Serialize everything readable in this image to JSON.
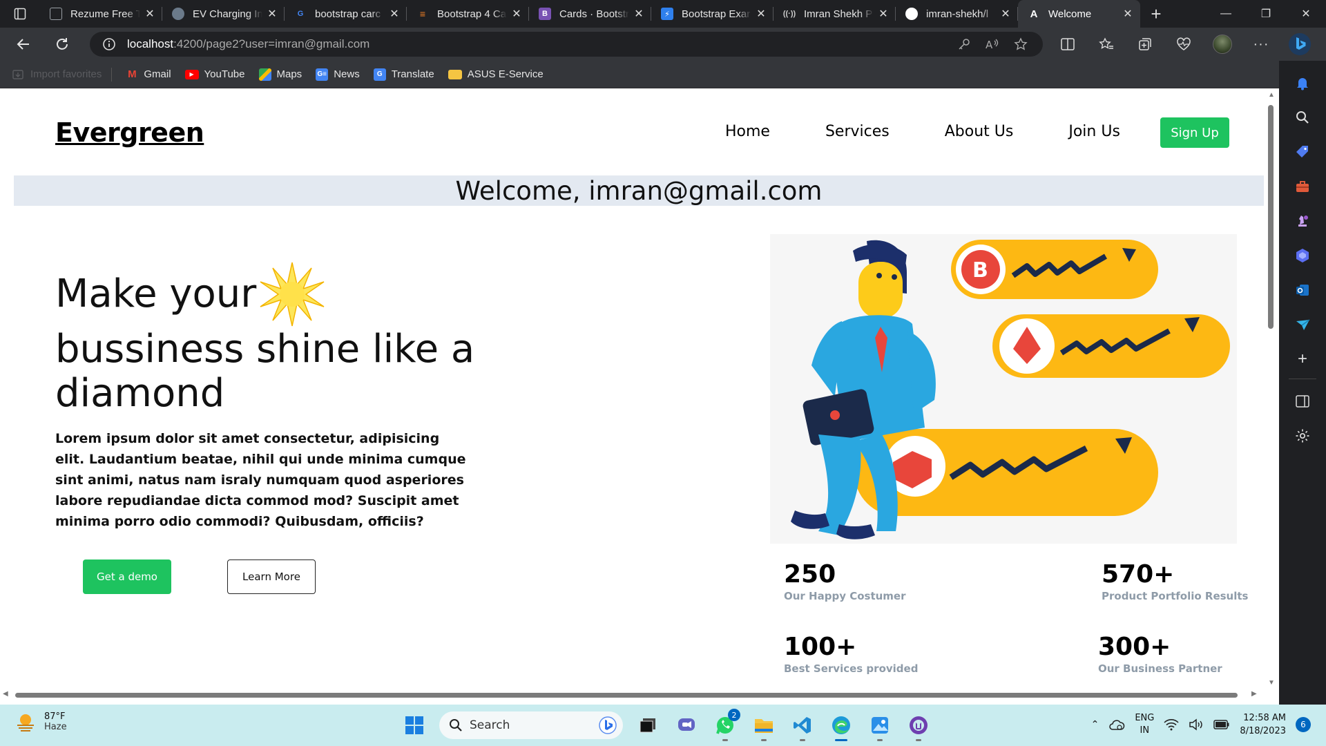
{
  "browser": {
    "tabs": [
      {
        "title": "Rezume Free T",
        "favicon_color": "#9aa0a6",
        "active": false
      },
      {
        "title": "EV Charging In",
        "favicon_color": "#6b7a8a",
        "active": false
      },
      {
        "title": "bootstrap carc",
        "favicon_color": "#4285f4",
        "active": false
      },
      {
        "title": "Bootstrap 4 Ca",
        "favicon_color": "#f48024",
        "active": false
      },
      {
        "title": "Cards · Bootstr",
        "favicon_color": "#7952b3",
        "active": false
      },
      {
        "title": "Bootstrap Exar",
        "favicon_color": "#2f80ed",
        "active": false
      },
      {
        "title": "Imran Shekh P",
        "favicon_color": "#cfcfcf",
        "active": false
      },
      {
        "title": "imran-shekh/l",
        "favicon_color": "#ffffff",
        "active": false
      },
      {
        "title": "Welcome",
        "favicon_color": "#ffffff",
        "active": true
      }
    ],
    "url": {
      "host": "localhost",
      "path": ":4200/page2?user=imran@gmail.com"
    },
    "favorites": [
      {
        "label": "Import favorites",
        "icon": "import-icon",
        "color": "#5a5b5f"
      },
      {
        "label": "Gmail",
        "icon": "gmail-icon",
        "color": "#ea4335"
      },
      {
        "label": "YouTube",
        "icon": "youtube-icon",
        "color": "#ff0000"
      },
      {
        "label": "Maps",
        "icon": "maps-icon",
        "color": "#34a853"
      },
      {
        "label": "News",
        "icon": "news-icon",
        "color": "#4285f4"
      },
      {
        "label": "Translate",
        "icon": "translate-icon",
        "color": "#4285f4"
      },
      {
        "label": "ASUS E-Service",
        "icon": "folder-icon",
        "color": "#f5c542"
      }
    ]
  },
  "page": {
    "brand": "Evergreen",
    "nav": [
      "Home",
      "Services",
      "About Us",
      "Join Us"
    ],
    "signup": "Sign Up",
    "welcome": "Welcome, imran@gmail.com",
    "hero": {
      "line1": "Make your",
      "line2": "bussiness shine like a diamond",
      "text": "Lorem ipsum dolor sit amet consectetur, adipisicing elit. Laudantium beatae, nihil qui unde minima cumque sint animi, natus nam israly numquam quod asperiores labore repudiandae dicta commod mod? Suscipit amet minima porro odio commodi? Quibusdam, officiis?",
      "demo_button": "Get a demo",
      "learn_button": "Learn More"
    },
    "stats": [
      {
        "num": "250",
        "label": "Our Happy Costumer"
      },
      {
        "num": "570+",
        "label": "Product Portfolio Results"
      },
      {
        "num": "100+",
        "label": "Best Services provided"
      },
      {
        "num": "300+",
        "label": "Our Business Partner"
      }
    ],
    "colors": {
      "accent": "#1ec35f",
      "welcome_bg": "#e3e9f1",
      "stat_label": "#8e9ba8"
    }
  },
  "taskbar": {
    "weather": {
      "temp": "87°F",
      "condition": "Haze"
    },
    "search": "Search",
    "whatsapp_badge": "2",
    "lang": {
      "line1": "ENG",
      "line2": "IN"
    },
    "time": "12:58 AM",
    "date": "8/18/2023",
    "notifications": "6"
  }
}
